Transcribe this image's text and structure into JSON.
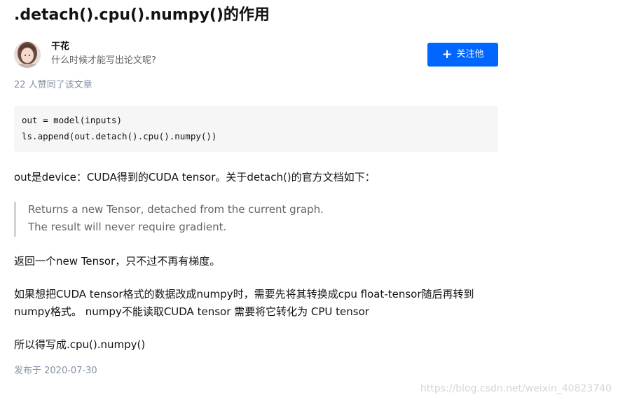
{
  "article": {
    "title": ".detach().cpu().numpy()的作用",
    "author": {
      "name": "干花",
      "bio": "什么时候才能写出论文呢?"
    },
    "follow_button": {
      "icon": "plus-icon",
      "label": "关注他"
    },
    "likes_text": "22 人赞同了该文章",
    "code_lines": [
      "out = model(inputs)",
      "ls.append(out.detach().cpu().numpy())"
    ],
    "paragraph_1": "out是device：CUDA得到的CUDA tensor。关于detach()的官方文档如下：",
    "quote_lines": [
      "Returns a new Tensor, detached from the current graph.",
      "The result will never require gradient."
    ],
    "paragraph_2": "返回一个new Tensor，只不过不再有梯度。",
    "paragraph_3": "如果想把CUDA tensor格式的数据改成numpy时，需要先将其转换成cpu float-tensor随后再转到numpy格式。 numpy不能读取CUDA tensor 需要将它转化为 CPU tensor",
    "paragraph_4": "所以得写成.cpu().numpy()",
    "published": "发布于 2020-07-30"
  },
  "watermark": "https://blog.csdn.net/weixin_40823740",
  "colors": {
    "accent": "#0066ff",
    "muted": "#8590a6",
    "code_bg": "#f6f6f6",
    "quote_border": "#d3d3d3"
  }
}
